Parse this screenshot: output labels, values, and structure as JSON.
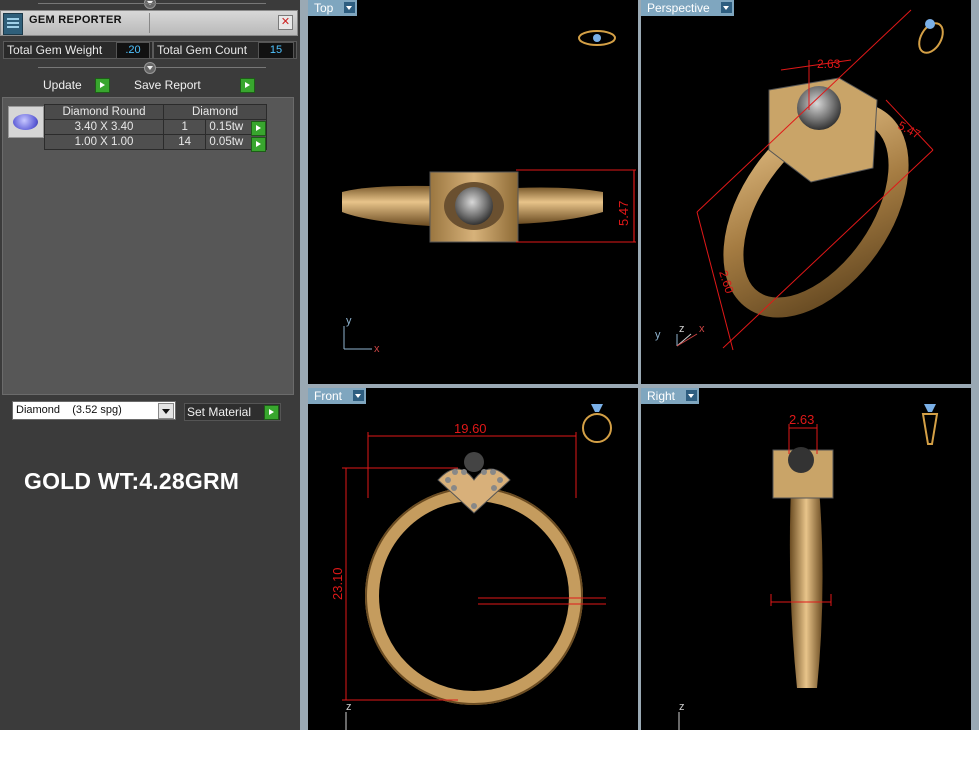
{
  "panel": {
    "title": "GEM REPORTER",
    "close_label": "✕",
    "total_gem_weight_label": "Total Gem Weight",
    "total_gem_weight_value": ".20",
    "total_gem_count_label": "Total Gem Count",
    "total_gem_count_value": "15",
    "update_label": "Update",
    "save_report_label": "Save Report",
    "gem_table": {
      "headers": [
        "Diamond Round",
        "Diamond"
      ],
      "rows": [
        {
          "size": "3.40 X 3.40",
          "count": "1",
          "weight": "0.15tw"
        },
        {
          "size": "1.00 X 1.00",
          "count": "14",
          "weight": "0.05tw"
        }
      ]
    },
    "material_select": {
      "name": "Diamond",
      "spg": "(3.52 spg)"
    },
    "set_material_label": "Set Material",
    "gold_weight_text": "GOLD WT:4.28GRM"
  },
  "viewports": {
    "top": {
      "label": "Top",
      "dimensions": [
        "5.47"
      ],
      "axes": [
        "y",
        "x"
      ]
    },
    "perspective": {
      "label": "Perspective",
      "dimensions": [
        "2.63",
        "5.47",
        "2.60"
      ],
      "axes": [
        "y",
        "z",
        "x"
      ]
    },
    "front": {
      "label": "Front",
      "dimensions": [
        "19.60",
        "23.10"
      ],
      "axes": [
        "z"
      ]
    },
    "right": {
      "label": "Right",
      "dimensions": [
        "2.63"
      ],
      "axes": [
        "z"
      ]
    }
  },
  "colors": {
    "panel_bg": "#3b3b3b",
    "viewport_bg": "#000000",
    "tab_bg": "#7fa6bf",
    "dimension_red": "#e01818",
    "gold": "#c8a064",
    "value_blue": "#4fc3ff",
    "go_green": "#38a62e"
  }
}
